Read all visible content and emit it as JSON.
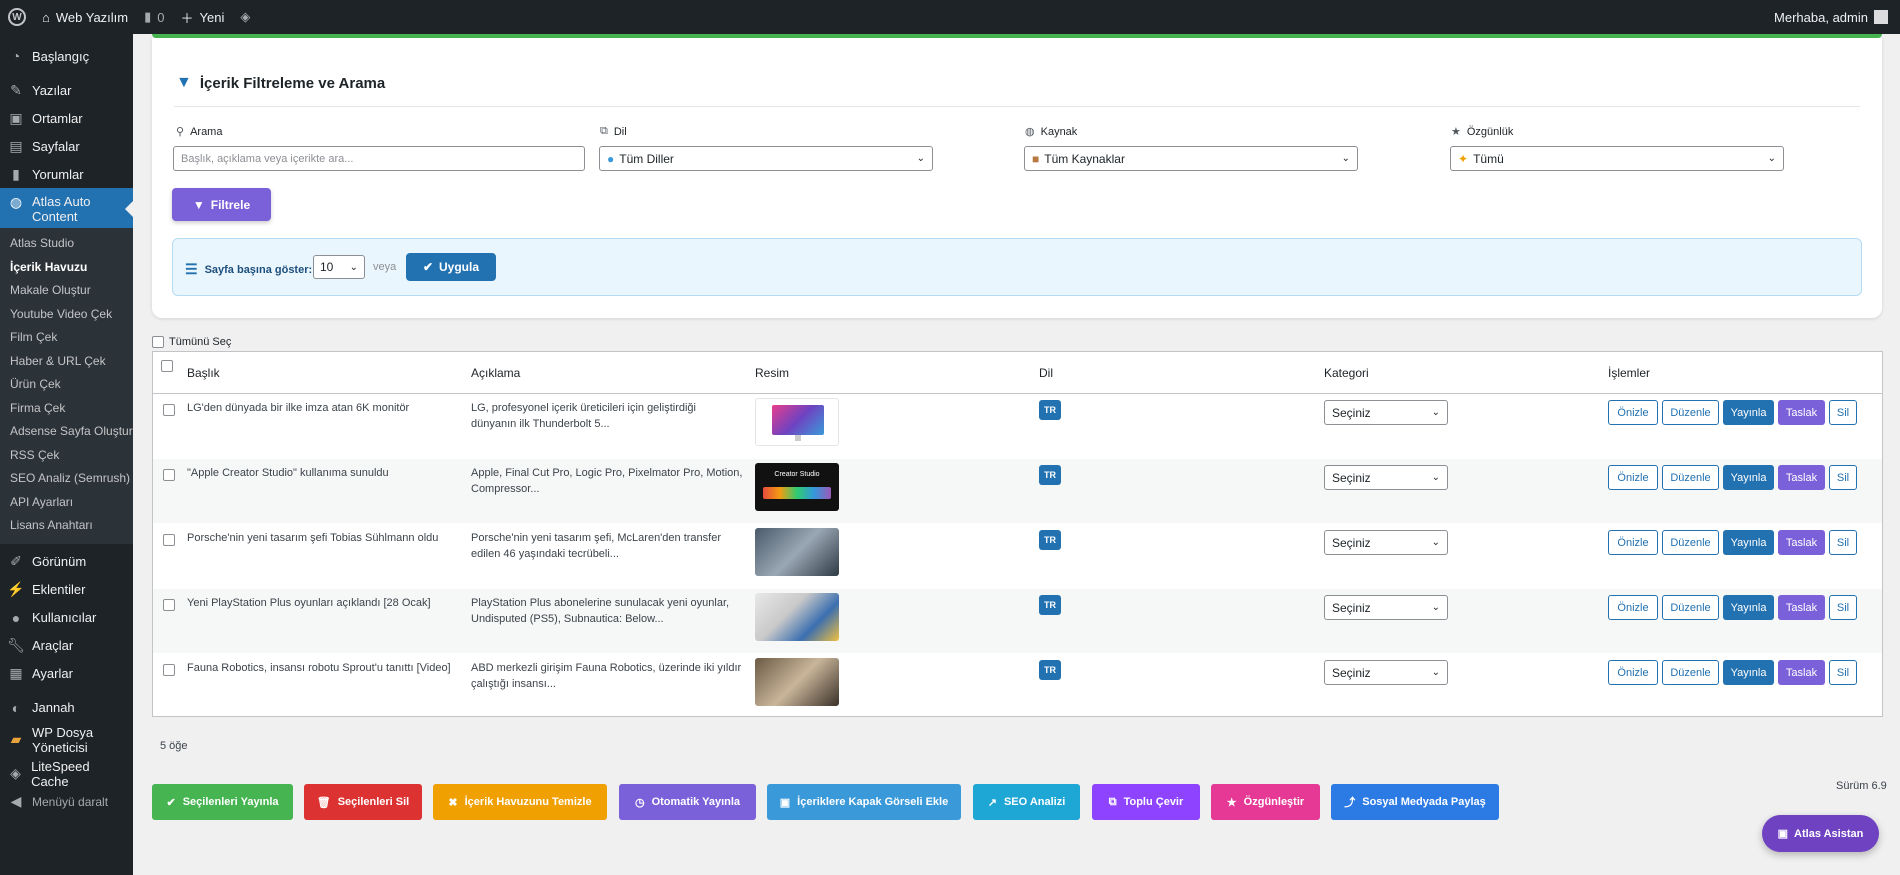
{
  "adminbar": {
    "site_name": "Web Yazılım",
    "comments_count": "0",
    "new_label": "Yeni",
    "greeting": "Merhaba, admin"
  },
  "sidebar": {
    "items_top": [
      {
        "label": "Başlangıç",
        "icon": "dashboard-icon"
      },
      {
        "label": "Yazılar",
        "icon": "pin-icon"
      },
      {
        "label": "Ortamlar",
        "icon": "media-icon"
      },
      {
        "label": "Sayfalar",
        "icon": "page-icon"
      },
      {
        "label": "Yorumlar",
        "icon": "comment-icon"
      }
    ],
    "active": {
      "label": "Atlas Auto Content",
      "icon": "globe-icon"
    },
    "submenu": [
      "Atlas Studio",
      "İçerik Havuzu",
      "Makale Oluştur",
      "Youtube Video Çek",
      "Film Çek",
      "Haber & URL Çek",
      "Ürün Çek",
      "Firma Çek",
      "Adsense Sayfa Oluştur",
      "RSS Çek",
      "SEO Analiz (Semrush)",
      "API Ayarları",
      "Lisans Anahtarı"
    ],
    "submenu_current": "İçerik Havuzu",
    "items_bottom": [
      {
        "label": "Görünüm",
        "icon": "brush-icon"
      },
      {
        "label": "Eklentiler",
        "icon": "plugin-icon"
      },
      {
        "label": "Kullanıcılar",
        "icon": "users-icon"
      },
      {
        "label": "Araçlar",
        "icon": "wrench-icon"
      },
      {
        "label": "Ayarlar",
        "icon": "settings-icon"
      },
      {
        "label": "Jannah",
        "icon": "jannah-icon"
      },
      {
        "label": "WP Dosya Yöneticisi",
        "icon": "folder-icon"
      },
      {
        "label": "LiteSpeed Cache",
        "icon": "diamond-icon"
      },
      {
        "label": "Menüyü daralt",
        "icon": "collapse-icon"
      }
    ]
  },
  "filter": {
    "title": "İçerik Filtreleme ve Arama",
    "search_label": "Arama",
    "search_placeholder": "Başlık, açıklama veya içerikte ara...",
    "lang_label": "Dil",
    "lang_value": "Tüm Diller",
    "source_label": "Kaynak",
    "source_value": "Tüm Kaynaklar",
    "originality_label": "Özgünlük",
    "originality_value": "Tümü",
    "filter_button": "Filtrele",
    "per_page_label": "Sayfa başına göster:",
    "per_page_value": "10",
    "or_text": "veya",
    "apply_button": "Uygula"
  },
  "table": {
    "select_all": "Tümünü Seç",
    "headers": {
      "title": "Başlık",
      "desc": "Açıklama",
      "image": "Resim",
      "lang": "Dil",
      "category": "Kategori",
      "actions": "İşlemler"
    },
    "rows": [
      {
        "title": "LG'den dünyada bir ilke imza atan 6K monitör",
        "desc1": "LG, profesyonel içerik üreticileri için geliştirdiği",
        "desc2": "dünyanın ilk Thunderbolt 5...",
        "lang": "TR",
        "category": "Seçiniz",
        "thumb": "monitor"
      },
      {
        "title": "\"Apple Creator Studio\" kullanıma sunuldu",
        "desc1": "Apple, Final Cut Pro, Logic Pro, Pixelmator Pro, Motion,",
        "desc2": "Compressor...",
        "lang": "TR",
        "category": "Seçiniz",
        "thumb": "creator",
        "thumb_text": "Creator Studio"
      },
      {
        "title": "Porsche'nin yeni tasarım şefi Tobias Sühlmann oldu",
        "desc1": "Porsche'nin yeni tasarım şefi, McLaren'den transfer",
        "desc2": "edilen 46 yaşındaki tecrübeli...",
        "lang": "TR",
        "category": "Seçiniz",
        "thumb": "porsche"
      },
      {
        "title": "Yeni PlayStation Plus oyunları açıklandı [28 Ocak]",
        "desc1": "PlayStation Plus abonelerine sunulacak yeni oyunlar,",
        "desc2": "Undisputed (PS5), Subnautica: Below...",
        "lang": "TR",
        "category": "Seçiniz",
        "thumb": "playstation"
      },
      {
        "title": "Fauna Robotics, insansı robotu Sprout'u tanıttı [Video]",
        "desc1": "ABD merkezli girişim Fauna Robotics, üzerinde iki yıldır",
        "desc2": "çalıştığı insansı...",
        "lang": "TR",
        "category": "Seçiniz",
        "thumb": "robot"
      }
    ],
    "actions": {
      "preview": "Önizle",
      "edit": "Düzenle",
      "publish": "Yayınla",
      "draft": "Taslak",
      "delete": "Sil"
    }
  },
  "footer": {
    "count": "5 öğe",
    "version": "Sürüm 6.9",
    "bulk": [
      {
        "label": "Seçilenleri Yayınla",
        "icon": "check-circle-icon",
        "color": "#46b450"
      },
      {
        "label": "Seçilenleri Sil",
        "icon": "trash-icon",
        "color": "#dc3232"
      },
      {
        "label": "İçerik Havuzunu Temizle",
        "icon": "x-circle-icon",
        "color": "#f0a000"
      },
      {
        "label": "Otomatik Yayınla",
        "icon": "clock-icon",
        "color": "#7b61d9"
      },
      {
        "label": "İçeriklere Kapak Görseli Ekle",
        "icon": "image-icon",
        "color": "#3a9ad9"
      },
      {
        "label": "SEO Analizi",
        "icon": "chart-icon",
        "color": "#1ea7d4"
      },
      {
        "label": "Toplu Çevir",
        "icon": "translate-icon",
        "color": "#8e44ff"
      },
      {
        "label": "Özgünleştir",
        "icon": "star-icon",
        "color": "#e53995"
      },
      {
        "label": "Sosyal Medyada Paylaş",
        "icon": "share-icon",
        "color": "#2c7be5"
      }
    ],
    "assistant": "Atlas Asistan"
  },
  "colors": {
    "primary": "#2271b1",
    "purple": "#7b61d9",
    "green": "#46b450",
    "sidebar": "#1d2327"
  }
}
